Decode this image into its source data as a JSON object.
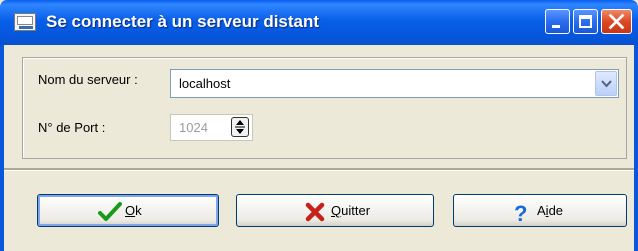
{
  "window": {
    "title": "Se connecter à un serveur distant"
  },
  "form": {
    "server_label": "Nom du serveur :",
    "server_value": "localhost",
    "port_label": "N° de Port :",
    "port_value": "1024"
  },
  "buttons": {
    "ok": {
      "hotkey": "O",
      "rest": "k",
      "icon": "checkmark-icon"
    },
    "quit": {
      "hotkey": "Q",
      "rest": "uitter",
      "icon": "red-x-icon"
    },
    "help": {
      "prefix": "A",
      "hotkey": "i",
      "rest": "de",
      "icon": "question-mark-icon"
    }
  },
  "colors": {
    "titlebar": "#0a5fe8",
    "dialog_bg": "#ece9d8",
    "ok_icon": "#1a9a1a",
    "quit_icon": "#c8201a",
    "help_icon": "#1a6ad8"
  }
}
